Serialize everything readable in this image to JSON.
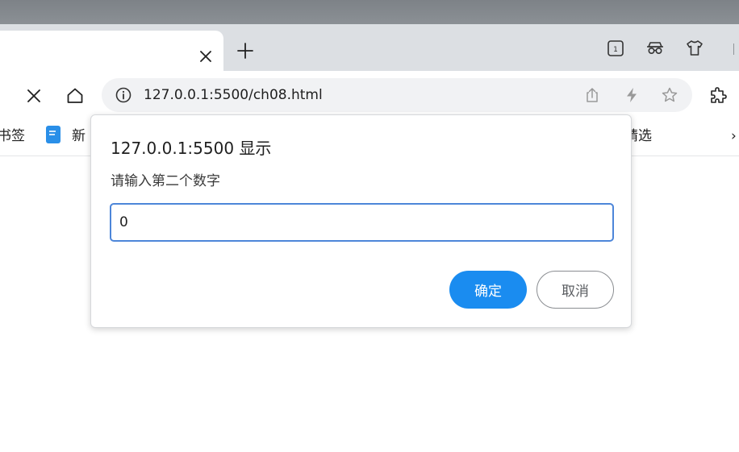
{
  "tabs": {
    "new_tab_glyph": "+"
  },
  "toolbar": {
    "address": "127.0.0.1:5500/ch08.html",
    "tab_count_badge": "1"
  },
  "bookmarks": {
    "items": [
      {
        "label": "书签"
      },
      {
        "label": "新"
      },
      {
        "label": "精选"
      }
    ],
    "more_glyph": "›"
  },
  "dialog": {
    "title": "127.0.0.1:5500 显示",
    "message": "请输入第二个数字",
    "input_value": "0",
    "ok_label": "确定",
    "cancel_label": "取消"
  },
  "icons": {
    "tab_close": "close-icon",
    "new_tab": "plus-icon",
    "tab_counter": "tab-counter-icon",
    "incognito": "glasses-icon",
    "skin": "tshirt-icon",
    "stop": "close-icon",
    "home": "home-icon",
    "site_info": "info-icon",
    "share": "share-icon",
    "flash": "lightning-icon",
    "favorite": "star-icon",
    "extensions": "puzzle-icon",
    "bookmark_doc": "document-icon"
  },
  "colors": {
    "accent": "#1a8cf0",
    "input_border": "#4d86d9",
    "tabstrip": "#dcdfe3",
    "omnibox": "#f1f2f4"
  }
}
